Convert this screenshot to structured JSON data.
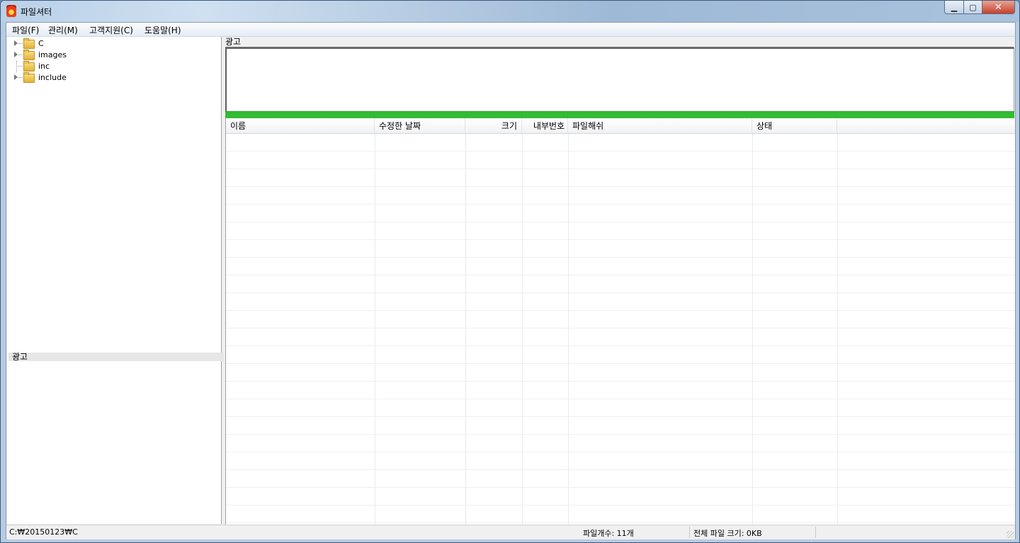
{
  "window": {
    "title": "파일셔터"
  },
  "menu": {
    "items": [
      {
        "label": "파일(F)"
      },
      {
        "label": "관리(M)"
      },
      {
        "label": "고객지원(C)"
      },
      {
        "label": "도움말(H)"
      }
    ]
  },
  "tree": {
    "items": [
      {
        "label": "C",
        "expandable": true
      },
      {
        "label": "images",
        "expandable": true
      },
      {
        "label": "inc",
        "expandable": false
      },
      {
        "label": "include",
        "expandable": true
      }
    ]
  },
  "ads": {
    "left_label": "광고",
    "top_label": "광고"
  },
  "progress": {
    "percent": 100,
    "color": "#33bb33"
  },
  "file_list": {
    "columns": [
      "이름",
      "수정한 날짜",
      "크기",
      "내부번호",
      "파일해쉬",
      "상태"
    ],
    "rows": []
  },
  "status": {
    "path": "C:₩20150123₩C",
    "file_count": "파일개수: 11개",
    "total_size": "전체 파일 크기: 0KB"
  }
}
